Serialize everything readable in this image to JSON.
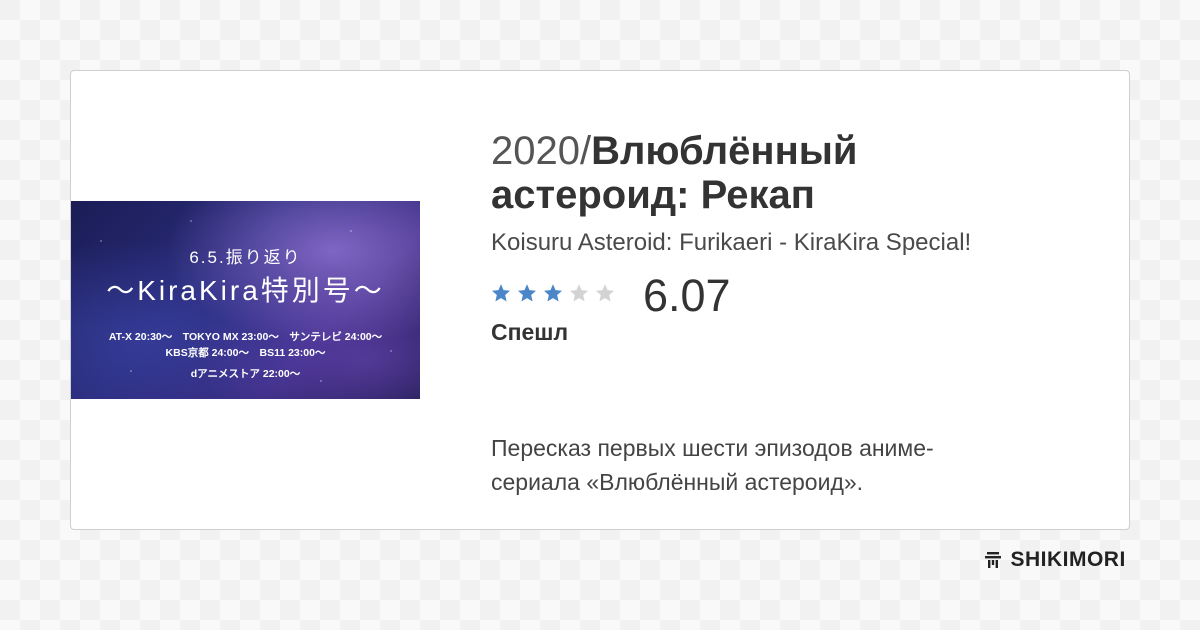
{
  "anime": {
    "year": "2020/",
    "title": "Влюблённый астероид: Рекап",
    "original_title": "Koisuru Asteroid: Furikaeri - KiraKira Special!",
    "score": "6.07",
    "stars_filled": 3,
    "stars_total": 5,
    "kind": "Спешл",
    "description": "Пересказ первых шести эпизодов аниме-сериала «Влюблённый астероид»."
  },
  "poster": {
    "line1": "6.5.振り返り",
    "line2": "〜KiraKira特別号〜",
    "line3": "AT-X 20:30〜　TOKYO MX 23:00〜　サンテレビ 24:00〜",
    "line4": "KBS京都 24:00〜　BS11 23:00〜",
    "line5": "dアニメストア 22:00〜"
  },
  "brand": {
    "name": "SHIKIMORI",
    "icon": "shikimori-logo-icon"
  },
  "colors": {
    "star_filled": "#4a86c8",
    "star_empty": "#d3d3d3",
    "text": "#333333"
  }
}
